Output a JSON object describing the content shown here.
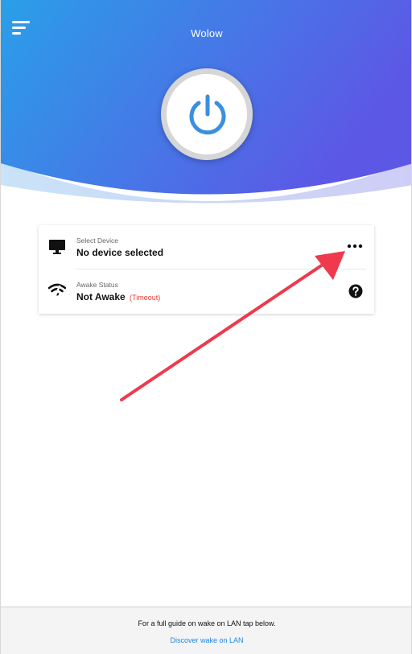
{
  "app": {
    "title": "Wolow"
  },
  "header": {
    "gradient_start": "#2a9be6",
    "gradient_end": "#5b5ee6",
    "accent_blue": "#3a8fe0"
  },
  "device": {
    "label": "Select Device",
    "value": "No device selected",
    "icon": "monitor-icon",
    "action_icon": "more-horizontal-icon"
  },
  "status": {
    "label": "Awake Status",
    "value": "Not Awake",
    "timeout": "(Timeout)",
    "icon": "wifi-off-icon",
    "action_icon": "help-icon"
  },
  "annotation": {
    "arrow_color": "#f0394d"
  },
  "footer": {
    "text": "For a full guide on wake on LAN tap below.",
    "link": "Discover wake on LAN"
  }
}
